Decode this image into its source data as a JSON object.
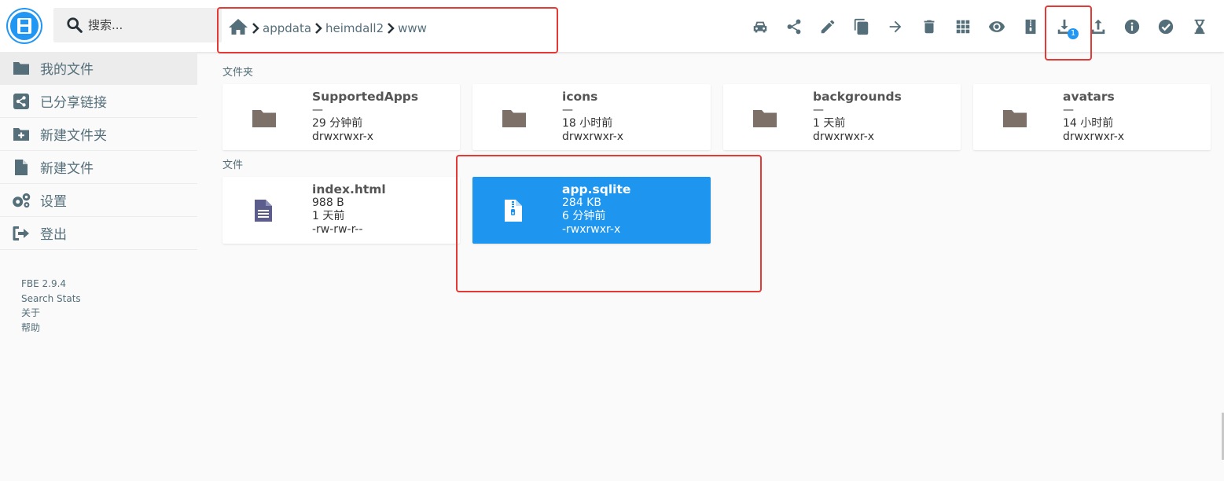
{
  "header": {
    "search_placeholder": "搜索...",
    "breadcrumb": [
      "appdata",
      "heimdall2",
      "www"
    ],
    "download_badge": "1"
  },
  "toolbar": [
    {
      "icon": "car-icon",
      "name": "toolbar-switch-view-button"
    },
    {
      "icon": "share-icon",
      "name": "toolbar-share-button"
    },
    {
      "icon": "pencil-icon",
      "name": "toolbar-rename-button"
    },
    {
      "icon": "copy-icon",
      "name": "toolbar-copy-button"
    },
    {
      "icon": "arrow-right-icon",
      "name": "toolbar-move-button"
    },
    {
      "icon": "trash-icon",
      "name": "toolbar-delete-button"
    },
    {
      "icon": "grid-icon",
      "name": "toolbar-view-mode-button"
    },
    {
      "icon": "eye-icon",
      "name": "toolbar-preview-button"
    },
    {
      "icon": "archive-icon",
      "name": "toolbar-archive-button"
    },
    {
      "icon": "download-icon",
      "name": "toolbar-download-button"
    },
    {
      "icon": "upload-icon",
      "name": "toolbar-upload-button"
    },
    {
      "icon": "info-icon",
      "name": "toolbar-info-button"
    },
    {
      "icon": "check-circle-icon",
      "name": "toolbar-select-button"
    },
    {
      "icon": "hourglass-icon",
      "name": "toolbar-pending-button"
    }
  ],
  "sidebar": {
    "items": [
      {
        "label": "我的文件",
        "icon": "folder-icon"
      },
      {
        "label": "已分享链接",
        "icon": "share-square-icon"
      },
      {
        "label": "新建文件夹",
        "icon": "folder-plus-icon"
      },
      {
        "label": "新建文件",
        "icon": "file-icon"
      },
      {
        "label": "设置",
        "icon": "gears-icon"
      },
      {
        "label": "登出",
        "icon": "logout-icon"
      }
    ],
    "credits": [
      "FBE 2.9.4",
      "Search Stats",
      "关于",
      "帮助"
    ]
  },
  "sections": {
    "folders_label": "文件夹",
    "files_label": "文件"
  },
  "folders": [
    {
      "name": "SupportedApps",
      "size": "—",
      "modified": "29 分钟前",
      "perms": "drwxrwxr-x"
    },
    {
      "name": "icons",
      "size": "—",
      "modified": "18 小时前",
      "perms": "drwxrwxr-x"
    },
    {
      "name": "backgrounds",
      "size": "—",
      "modified": "1 天前",
      "perms": "drwxrwxr-x"
    },
    {
      "name": "avatars",
      "size": "—",
      "modified": "14 小时前",
      "perms": "drwxrwxr-x"
    }
  ],
  "files": [
    {
      "name": "index.html",
      "size": "988 B",
      "modified": "1 天前",
      "perms": "-rw-rw-r--"
    },
    {
      "name": "app.sqlite",
      "size": "284 KB",
      "modified": "6 分钟前",
      "perms": "-rwxrwxr-x"
    }
  ],
  "colors": {
    "accent": "#2196f3",
    "selected_card": "#1e96f0",
    "highlight": "#e53935",
    "icon": "#546e7a",
    "folder": "#7d7069",
    "file_doc": "#5c5d8c"
  }
}
